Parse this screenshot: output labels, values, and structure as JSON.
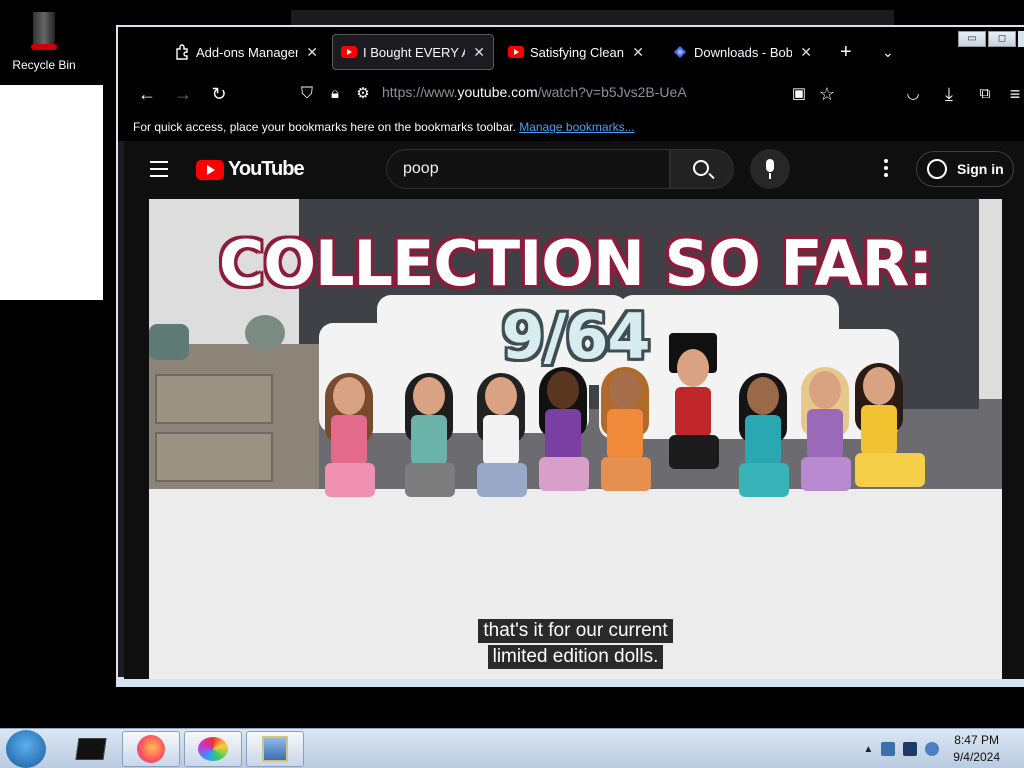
{
  "desktop": {
    "recycle_bin_label": "Recycle Bin"
  },
  "browser": {
    "tabs": [
      {
        "label": "Add-ons Manager",
        "icon": "puzzle-icon"
      },
      {
        "label": "I Bought EVERY Am",
        "icon": "youtube-icon",
        "active": true
      },
      {
        "label": "Satisfying Cleaning",
        "icon": "youtube-icon"
      },
      {
        "label": "Downloads - Bob Po",
        "icon": "download-puzzle-icon"
      }
    ],
    "new_tab": "+",
    "url_prefix": "https://www.",
    "url_host": "youtube.com",
    "url_path": "/watch?v=b5Jvs2B-UeA",
    "bookmarks_text": "For quick access, place your bookmarks here on the bookmarks toolbar.",
    "bookmarks_link": "Manage bookmarks..."
  },
  "youtube": {
    "logo_text": "YouTube",
    "search_value": "poop",
    "signin_label": "Sign in"
  },
  "video": {
    "overlay_title": "COLLECTION SO FAR: ",
    "overlay_count": "9/64",
    "caption_line1": "that's it for our current",
    "caption_line2": "limited edition dolls."
  },
  "taskbar": {
    "time": "8:47 PM",
    "date": "9/4/2024"
  },
  "colors": {
    "youtube_red": "#ff0000",
    "title_outline": "#8b1c3a",
    "link_blue": "#45a1ff"
  }
}
